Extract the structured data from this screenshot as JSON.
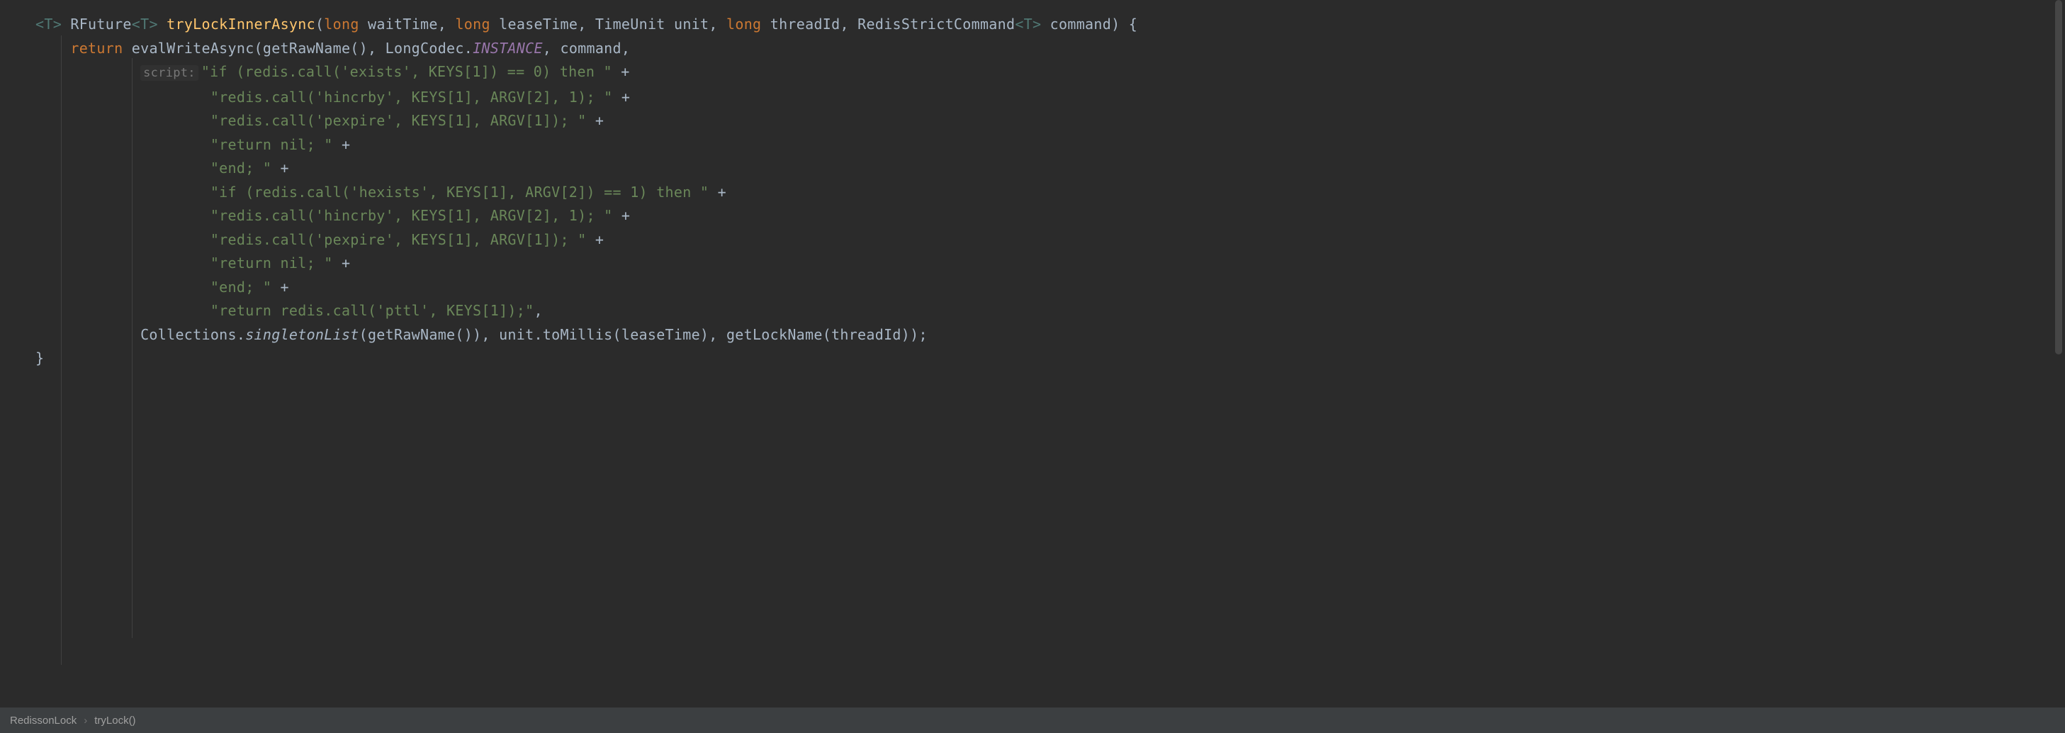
{
  "breadcrumb": {
    "class": "RedissonLock",
    "method": "tryLock()"
  },
  "code": {
    "sig": {
      "generic_open": "<",
      "generic_t": "T",
      "generic_close": ">",
      "return_type": "RFuture",
      "method_name": "tryLockInnerAsync",
      "kw_long": "long",
      "p1": " waitTime, ",
      "p2": " leaseTime, ",
      "p3_type": "TimeUnit",
      "p3_name": " unit, ",
      "p4": " threadId, ",
      "p5_type": "RedisStrictCommand",
      "p5_name": " command) {"
    },
    "ret": {
      "kw_return": "return",
      "call": " evalWriteAsync(getRawName(), LongCodec.",
      "instance": "INSTANCE",
      "after": ", command,"
    },
    "script_hint": "script:",
    "lines": {
      "l1": "\"if (redis.call('exists', KEYS[1]) == 0) then \"",
      "l2": "\"redis.call('hincrby', KEYS[1], ARGV[2], 1); \"",
      "l3": "\"redis.call('pexpire', KEYS[1], ARGV[1]); \"",
      "l4": "\"return nil; \"",
      "l5": "\"end; \"",
      "l6": "\"if (redis.call('hexists', KEYS[1], ARGV[2]) == 1) then \"",
      "l7": "\"redis.call('hincrby', KEYS[1], ARGV[2], 1); \"",
      "l8": "\"redis.call('pexpire', KEYS[1], ARGV[1]); \"",
      "l9": "\"return nil; \"",
      "l10": "\"end; \"",
      "l11": "\"return redis.call('pttl', KEYS[1]);\""
    },
    "plus": " +",
    "comma": ",",
    "args_line": {
      "prefix": "Collections.",
      "singleton": "singletonList",
      "rest": "(getRawName()), unit.toMillis(leaseTime), getLockName(threadId));"
    },
    "close_brace": "}"
  }
}
